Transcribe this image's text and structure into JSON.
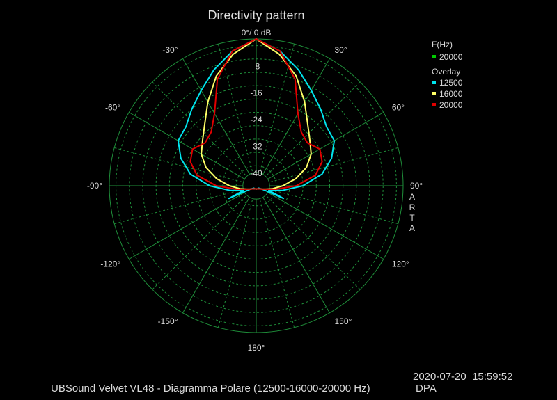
{
  "chart_data": {
    "type": "polar",
    "title": "Directivity pattern",
    "radial_unit_label": "0°/ 0 dB",
    "radial_ticks": [
      "-8",
      "-16",
      "-24",
      "-32",
      "-40"
    ],
    "radial_tick_values": [
      -8,
      -16,
      -24,
      -32,
      -40
    ],
    "radial_range": [
      -44,
      0
    ],
    "angle_labels": [
      {
        "deg": -30,
        "label": "-30°"
      },
      {
        "deg": 30,
        "label": "30°"
      },
      {
        "deg": -60,
        "label": "-60°"
      },
      {
        "deg": 60,
        "label": "60°"
      },
      {
        "deg": -90,
        "label": "-90°"
      },
      {
        "deg": 90,
        "label": "90°"
      },
      {
        "deg": -120,
        "label": "-120°"
      },
      {
        "deg": 120,
        "label": "120°"
      },
      {
        "deg": -150,
        "label": "-150°"
      },
      {
        "deg": 150,
        "label": "150°"
      },
      {
        "deg": 180,
        "label": "180°"
      }
    ],
    "side_label": "ARTA",
    "legend": {
      "freq_header": "F(Hz)",
      "freq_entry": {
        "label": "20000",
        "color": "#00cc00"
      },
      "overlay_header": "Overlay",
      "overlay_entries": [
        {
          "label": "12500",
          "color": "#00e5ee"
        },
        {
          "label": "16000",
          "color": "#ffff66"
        },
        {
          "label": "20000",
          "color": "#e00000"
        }
      ]
    },
    "series": [
      {
        "name": "12500",
        "color": "#00e5ee",
        "points": [
          [
            0,
            0
          ],
          [
            10,
            -3
          ],
          [
            20,
            -7
          ],
          [
            30,
            -11
          ],
          [
            40,
            -14
          ],
          [
            50,
            -16.5
          ],
          [
            60,
            -17
          ],
          [
            70,
            -20
          ],
          [
            80,
            -24
          ],
          [
            90,
            -30
          ],
          [
            100,
            -36
          ],
          [
            105,
            -38.5
          ],
          [
            110,
            -40
          ],
          [
            115,
            -35
          ],
          [
            120,
            -42
          ],
          [
            135,
            -43
          ],
          [
            150,
            -43
          ],
          [
            180,
            -43
          ],
          [
            -10,
            -3
          ],
          [
            -20,
            -7
          ],
          [
            -30,
            -11
          ],
          [
            -40,
            -14
          ],
          [
            -50,
            -16.5
          ],
          [
            -60,
            -17
          ],
          [
            -70,
            -20
          ],
          [
            -80,
            -24
          ],
          [
            -90,
            -30
          ],
          [
            -100,
            -36
          ],
          [
            -105,
            -38.5
          ],
          [
            -110,
            -40
          ],
          [
            -115,
            -35
          ],
          [
            -120,
            -42
          ],
          [
            -135,
            -43
          ],
          [
            -150,
            -43
          ]
        ]
      },
      {
        "name": "16000",
        "color": "#ffff66",
        "points": [
          [
            0,
            0
          ],
          [
            10,
            -4
          ],
          [
            20,
            -9
          ],
          [
            30,
            -15
          ],
          [
            40,
            -20
          ],
          [
            50,
            -23
          ],
          [
            60,
            -25
          ],
          [
            70,
            -28
          ],
          [
            80,
            -32
          ],
          [
            90,
            -36
          ],
          [
            100,
            -39
          ],
          [
            110,
            -41
          ],
          [
            120,
            -42
          ],
          [
            150,
            -43
          ],
          [
            180,
            -43
          ],
          [
            -10,
            -4
          ],
          [
            -20,
            -9
          ],
          [
            -30,
            -15
          ],
          [
            -40,
            -20
          ],
          [
            -50,
            -23
          ],
          [
            -60,
            -25
          ],
          [
            -70,
            -28
          ],
          [
            -80,
            -32
          ],
          [
            -90,
            -36
          ],
          [
            -100,
            -39
          ],
          [
            -110,
            -41
          ],
          [
            -120,
            -42
          ],
          [
            -150,
            -43
          ]
        ]
      },
      {
        "name": "20000",
        "color": "#e00000",
        "points": [
          [
            0,
            0
          ],
          [
            10,
            -3
          ],
          [
            20,
            -10
          ],
          [
            30,
            -19
          ],
          [
            40,
            -23
          ],
          [
            50,
            -24
          ],
          [
            60,
            -22
          ],
          [
            70,
            -23
          ],
          [
            80,
            -26
          ],
          [
            90,
            -32
          ],
          [
            100,
            -38
          ],
          [
            110,
            -41
          ],
          [
            120,
            -42
          ],
          [
            150,
            -43
          ],
          [
            180,
            -43
          ],
          [
            -10,
            -3
          ],
          [
            -20,
            -10
          ],
          [
            -30,
            -19
          ],
          [
            -40,
            -23
          ],
          [
            -50,
            -24
          ],
          [
            -60,
            -22
          ],
          [
            -70,
            -23
          ],
          [
            -80,
            -26
          ],
          [
            -90,
            -32
          ],
          [
            -100,
            -38
          ],
          [
            -110,
            -41
          ],
          [
            -120,
            -42
          ],
          [
            -150,
            -43
          ]
        ]
      }
    ]
  },
  "footer": {
    "datetime": "2020-07-20  15:59:52",
    "caption": "UBSound Velvet VL48 - Diagramma Polare (12500-16000-20000 Hz)",
    "tag": "DPA"
  },
  "colors": {
    "grid": "#1f8f3a",
    "background": "#000000",
    "text": "#d8d8d8"
  }
}
